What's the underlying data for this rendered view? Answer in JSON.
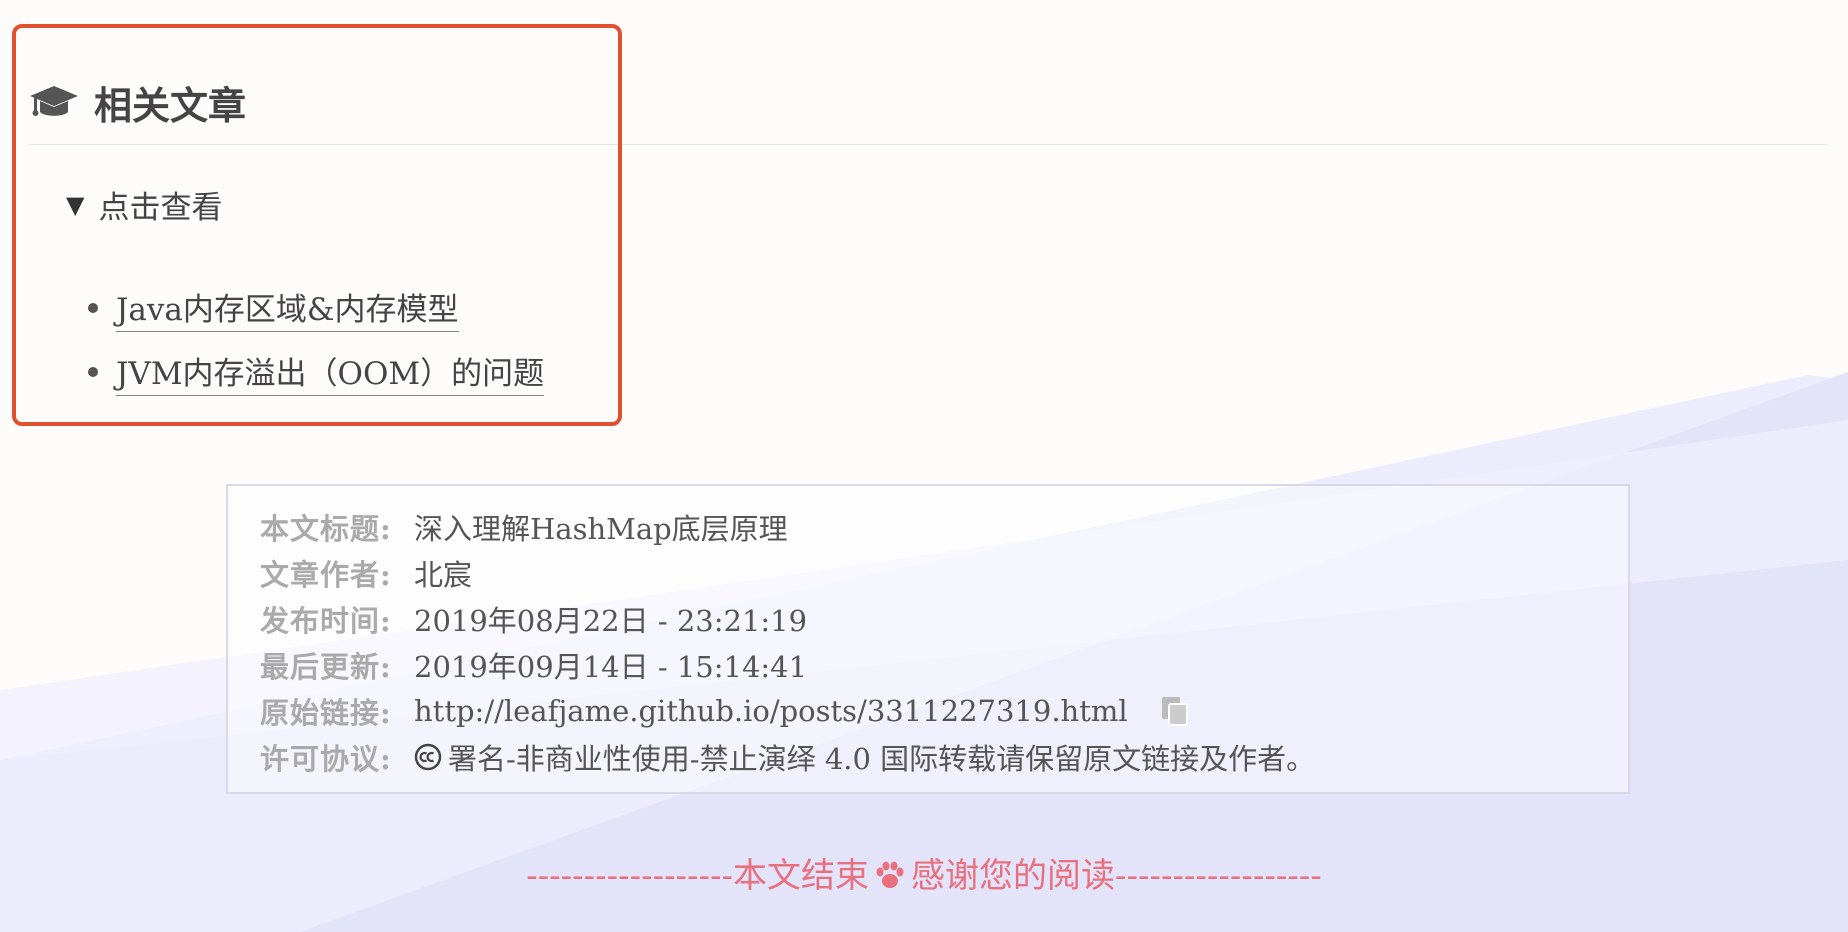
{
  "related": {
    "heading": "相关文章",
    "heading_icon": "graduation-cap-icon",
    "summary_marker": "▼",
    "summary": "点击查看",
    "items": [
      {
        "label": "Java内存区域&内存模型"
      },
      {
        "label": "JVM内存溢出（OOM）的问题"
      }
    ]
  },
  "copyright": {
    "rows": {
      "title": {
        "label": "本文标题:",
        "value": "深入理解HashMap底层原理"
      },
      "author": {
        "label": "文章作者:",
        "value": "北宸"
      },
      "published": {
        "label": "发布时间:",
        "value": "2019年08月22日 - 23:21:19"
      },
      "updated": {
        "label": "最后更新:",
        "value": "2019年09月14日 - 15:14:41"
      },
      "link": {
        "label": "原始链接:",
        "value": "http://leafjame.github.io/posts/3311227319.html"
      },
      "license": {
        "label": "许可协议:",
        "value": "署名-非商业性使用-禁止演绎 4.0 国际",
        "suffix": " 转载请保留原文链接及作者。"
      }
    }
  },
  "end_line": {
    "left": "------------------本文结束",
    "right": "感谢您的阅读------------------",
    "icon": "paw-icon"
  },
  "colors": {
    "highlight_border": "#e2512f",
    "end_line": "#e8707f",
    "background_shape": "#e6e6fb"
  }
}
